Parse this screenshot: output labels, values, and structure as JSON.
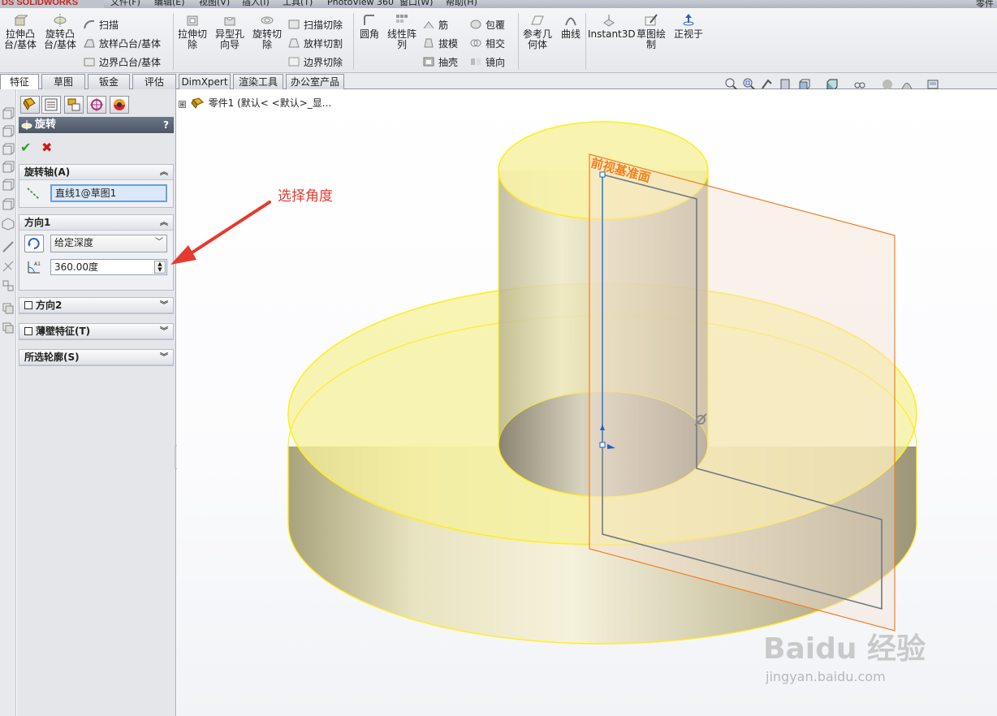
{
  "app": {
    "logo": "SOLIDWORKS",
    "logo_prefix": "DS",
    "corner_text": "零件"
  },
  "menu": {
    "items": [
      "文件(F)",
      "编辑(E)",
      "视图(V)",
      "插入(I)",
      "工具(T)",
      "PhotoView 360",
      "窗口(W)",
      "帮助(H)"
    ]
  },
  "ribbon": {
    "extrude_boss": "拉伸凸台/基体",
    "extrude_boss_l1": "拉伸凸",
    "extrude_boss_l2": "台/基体",
    "revolve_boss_l1": "旋转凸",
    "revolve_boss_l2": "台/基体",
    "sweep": "扫描",
    "loft": "放样凸台/基体",
    "boundary": "边界凸台/基体",
    "extrude_cut_l1": "拉伸切",
    "extrude_cut_l2": "除",
    "hole_wizard_l1": "异型孔",
    "hole_wizard_l2": "向导",
    "revolve_cut_l1": "旋转切",
    "revolve_cut_l2": "除",
    "swept_cut": "扫描切除",
    "lofted_cut": "放样切割",
    "boundary_cut": "边界切除",
    "fillet": "圆角",
    "linear_pattern_l1": "线性阵",
    "linear_pattern_l2": "列",
    "rib": "筋",
    "draft": "拔模",
    "shell": "抽壳",
    "wrap": "包覆",
    "intersect": "相交",
    "mirror": "镜向",
    "ref_geom_l1": "参考几",
    "ref_geom_l2": "何体",
    "curves": "曲线",
    "instant3d": "Instant3D",
    "sketch_l1": "草图绘",
    "sketch_l2": "制",
    "normal_to": "正视于"
  },
  "tabs": [
    "特征",
    "草图",
    "钣金",
    "评估",
    "DimXpert",
    "渲染工具",
    "办公室产品"
  ],
  "tree": {
    "expand": "⊞",
    "part_label": "零件1  (默认< <默认>_显..."
  },
  "pm": {
    "title": "旋转",
    "help": "?",
    "ok": "✔",
    "cancel": "✖",
    "axis_group": "旋转轴(A)",
    "axis_value": "直线1@草图1",
    "dir1_group": "方向1",
    "end_condition": "给定深度",
    "angle_value": "360.00度",
    "dir2_group": "方向2",
    "thin_group": "薄壁特征(T)",
    "contours_group": "所选轮廓(S)"
  },
  "scene": {
    "plane_label": "前视基准面"
  },
  "annotation": {
    "text": "选择角度"
  },
  "watermark": {
    "brand": "Baidu 经验",
    "url": "jingyan.baidu.com"
  },
  "colors": {
    "accent_red": "#e53a2e",
    "plane_orange": "#f08020",
    "highlight_yellow": "#ffff33",
    "title_bar": "#5a6676"
  }
}
